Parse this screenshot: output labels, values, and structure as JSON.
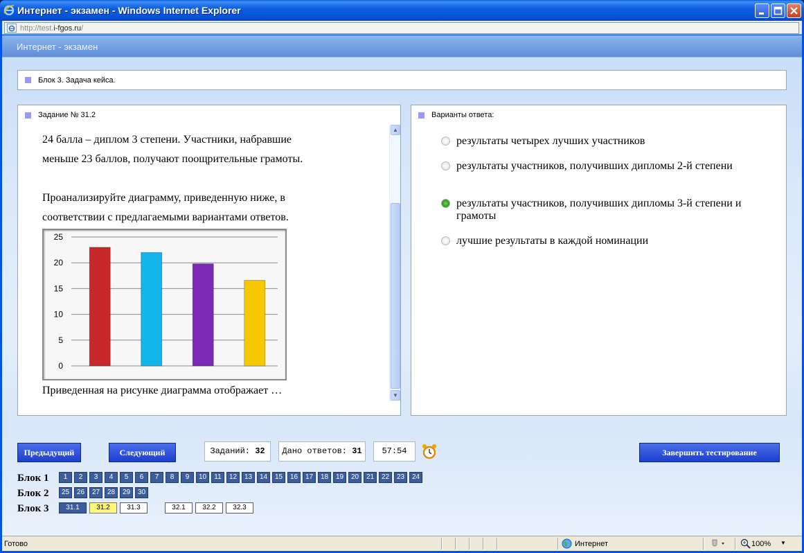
{
  "window": {
    "title": "Интернет - экзамен - Windows Internet Explorer"
  },
  "address": {
    "url_prefix": "http://test.",
    "url_host": "i-fgos.ru",
    "url_suffix": "/"
  },
  "app": {
    "header_title": "Интернет - экзамен"
  },
  "block": {
    "title": "Блок 3. Задача кейса."
  },
  "task": {
    "header": "Задание № 31.2",
    "lines": [
      "24 балла – диплом 3 степени. Участники, набравшие",
      "меньше 23 баллов, получают поощрительные грамоты.",
      "Проанализируйте диаграмму, приведенную ниже, в",
      "соответствии с предлагаемыми вариантами ответов.",
      "Приведенная на рисунке диаграмма отображает …"
    ]
  },
  "chart_data": {
    "type": "bar",
    "categories": [
      "",
      "",
      "",
      ""
    ],
    "values": [
      23,
      22,
      19.8,
      16.6
    ],
    "colors": [
      "#c8282a",
      "#14b4ec",
      "#7a2ab4",
      "#f6c800"
    ],
    "ylim": [
      0,
      25
    ],
    "yticks": [
      "0",
      "5",
      "10",
      "15",
      "20",
      "25"
    ],
    "grid": true
  },
  "answers": {
    "header": "Варианты ответа:",
    "options": [
      {
        "label": "результаты четырех лучших участников",
        "checked": false
      },
      {
        "label": "результаты участников, получивших дипломы 2-й степени",
        "checked": false
      },
      {
        "label": "результаты участников, получивших дипломы 3-й степени и грамоты",
        "checked": true
      },
      {
        "label": "лучшие результаты в каждой номинации",
        "checked": false
      }
    ]
  },
  "controls": {
    "prev_label": "Предыдущий",
    "next_label": "Следующий",
    "tasks_label": "Заданий:",
    "tasks_count": "32",
    "answers_label": "Дано ответов:",
    "answers_count": "31",
    "timer": "57:54",
    "finish_label": "Завершить тестирование"
  },
  "blocks": {
    "block1_label": "Блок 1",
    "block2_label": "Блок 2",
    "block3_label": "Блок 3",
    "block1": [
      "1",
      "2",
      "3",
      "4",
      "5",
      "6",
      "7",
      "8",
      "9",
      "10",
      "11",
      "12",
      "13",
      "14",
      "15",
      "16",
      "17",
      "18",
      "19",
      "20",
      "21",
      "22",
      "23",
      "24"
    ],
    "block2": [
      "25",
      "26",
      "27",
      "28",
      "29",
      "30"
    ],
    "block3": [
      "31.1",
      "31.2",
      "31.3",
      "32.1",
      "32.2",
      "32.3"
    ],
    "current": "31.2"
  },
  "status": {
    "text": "Готово",
    "zone": "Интернет",
    "zoom": "100%"
  }
}
